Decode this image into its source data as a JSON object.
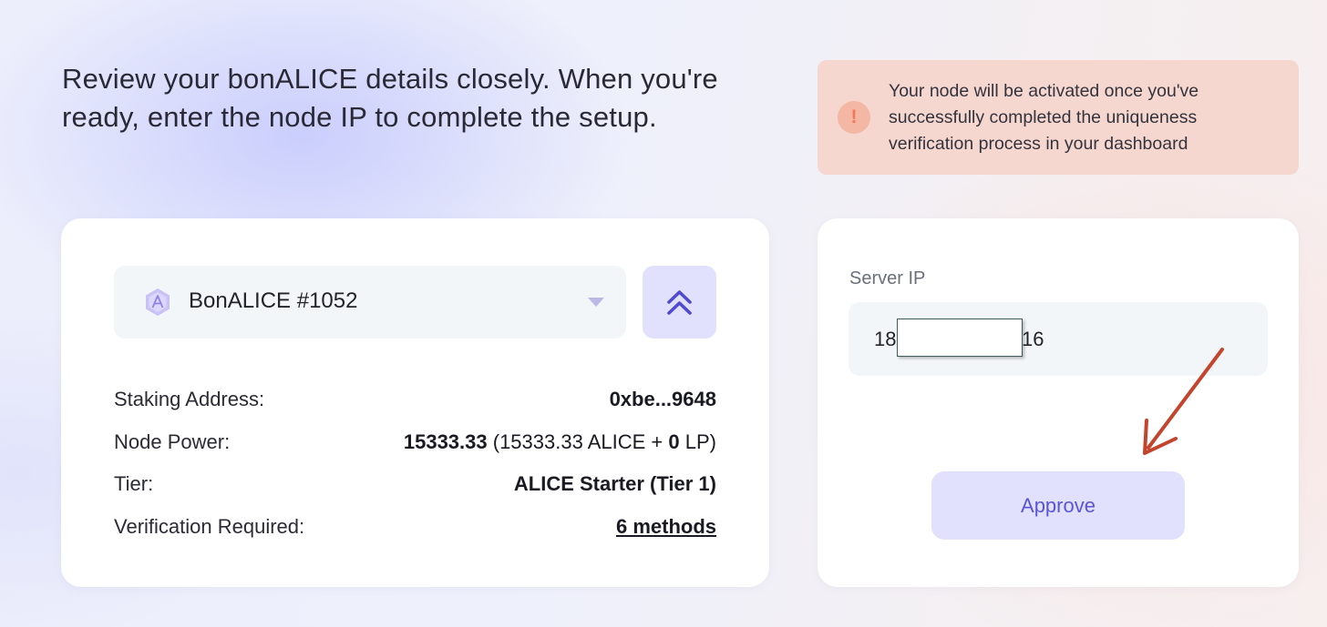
{
  "intro": {
    "text": "Review your bonALICE details closely. When you're ready, enter the node IP to complete the setup."
  },
  "alert": {
    "icon": "!",
    "text": "Your node will be activated once you've successfully completed the uniqueness verification process in your dashboard",
    "bg_color": "#f6d7cf",
    "icon_color": "#ef7a55"
  },
  "node_card": {
    "selector": {
      "icon": "bonalice-logo-icon",
      "label": "BonALICE #1052",
      "dropdown_icon": "caret-down-icon"
    },
    "collapse_icon": "double-chevron-up-icon",
    "details": [
      {
        "label": "Staking Address:",
        "value": "0xbe...9648"
      },
      {
        "label": "Node Power:",
        "value_bold": "15333.33",
        "value_mid": " (15333.33 ALICE + ",
        "value_bold2": "0",
        "value_end": " LP)"
      },
      {
        "label": "Tier:",
        "value": "ALICE Starter (Tier 1)"
      },
      {
        "label": "Verification Required:",
        "value": "6 methods"
      }
    ]
  },
  "ip_card": {
    "label": "Server IP",
    "ip_prefix": "18",
    "ip_suffix": "16",
    "approve_label": "Approve",
    "accent_color": "#5a55d8",
    "button_bg": "#e2e1fd"
  }
}
